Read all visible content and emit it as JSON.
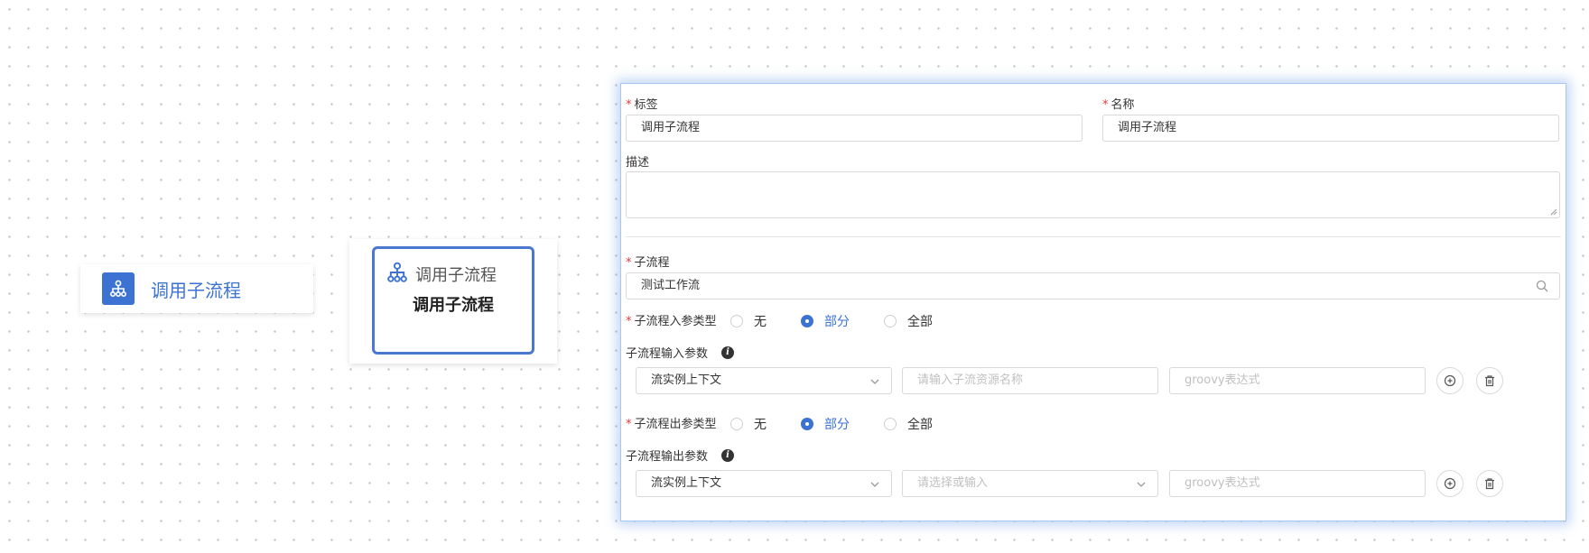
{
  "canvas": {
    "node_pill_label": "调用子流程",
    "node_card_title": "调用子流程",
    "node_card_name": "调用子流程",
    "icons": {
      "node": "org-chart-icon"
    },
    "colors": {
      "accent": "#3c73d3",
      "required": "#e4393c",
      "panel_glow": "#a8c7ef"
    }
  },
  "form": {
    "tag_label": "标签",
    "tag_value": "调用子流程",
    "name_label": "名称",
    "name_value": "调用子流程",
    "desc_label": "描述",
    "desc_value": "",
    "subflow_label": "子流程",
    "subflow_value": "测试工作流",
    "in_type_label": "子流程入参类型",
    "in_type_options": [
      "无",
      "部分",
      "全部"
    ],
    "in_type_selected": "部分",
    "in_params_label": "子流程输入参数",
    "in_row": {
      "source_value": "流实例上下文",
      "name_placeholder": "请输入子流资源名称",
      "expr_placeholder": "groovy表达式"
    },
    "out_type_label": "子流程出参类型",
    "out_type_options": [
      "无",
      "部分",
      "全部"
    ],
    "out_type_selected": "部分",
    "out_params_label": "子流程输出参数",
    "out_row": {
      "source_value": "流实例上下文",
      "name_placeholder": "请选择或输入",
      "expr_placeholder": "groovy表达式"
    }
  }
}
